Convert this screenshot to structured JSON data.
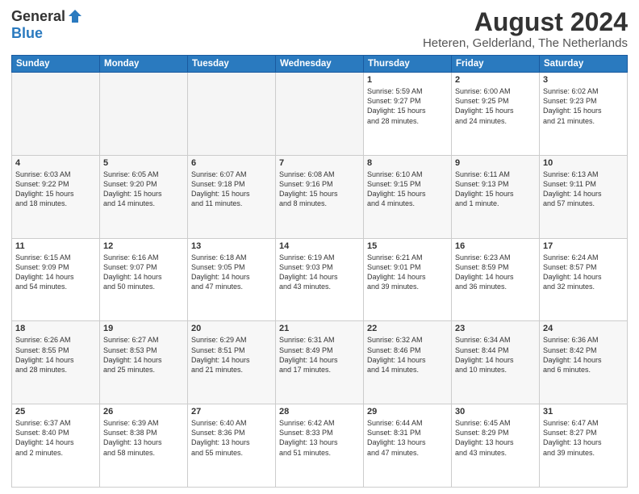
{
  "header": {
    "logo_general": "General",
    "logo_blue": "Blue",
    "month_year": "August 2024",
    "location": "Heteren, Gelderland, The Netherlands"
  },
  "days_of_week": [
    "Sunday",
    "Monday",
    "Tuesday",
    "Wednesday",
    "Thursday",
    "Friday",
    "Saturday"
  ],
  "weeks": [
    [
      {
        "day": "",
        "info": "",
        "empty": true
      },
      {
        "day": "",
        "info": "",
        "empty": true
      },
      {
        "day": "",
        "info": "",
        "empty": true
      },
      {
        "day": "",
        "info": "",
        "empty": true
      },
      {
        "day": "1",
        "info": "Sunrise: 5:59 AM\nSunset: 9:27 PM\nDaylight: 15 hours\nand 28 minutes."
      },
      {
        "day": "2",
        "info": "Sunrise: 6:00 AM\nSunset: 9:25 PM\nDaylight: 15 hours\nand 24 minutes."
      },
      {
        "day": "3",
        "info": "Sunrise: 6:02 AM\nSunset: 9:23 PM\nDaylight: 15 hours\nand 21 minutes."
      }
    ],
    [
      {
        "day": "4",
        "info": "Sunrise: 6:03 AM\nSunset: 9:22 PM\nDaylight: 15 hours\nand 18 minutes."
      },
      {
        "day": "5",
        "info": "Sunrise: 6:05 AM\nSunset: 9:20 PM\nDaylight: 15 hours\nand 14 minutes."
      },
      {
        "day": "6",
        "info": "Sunrise: 6:07 AM\nSunset: 9:18 PM\nDaylight: 15 hours\nand 11 minutes."
      },
      {
        "day": "7",
        "info": "Sunrise: 6:08 AM\nSunset: 9:16 PM\nDaylight: 15 hours\nand 8 minutes."
      },
      {
        "day": "8",
        "info": "Sunrise: 6:10 AM\nSunset: 9:15 PM\nDaylight: 15 hours\nand 4 minutes."
      },
      {
        "day": "9",
        "info": "Sunrise: 6:11 AM\nSunset: 9:13 PM\nDaylight: 15 hours\nand 1 minute."
      },
      {
        "day": "10",
        "info": "Sunrise: 6:13 AM\nSunset: 9:11 PM\nDaylight: 14 hours\nand 57 minutes."
      }
    ],
    [
      {
        "day": "11",
        "info": "Sunrise: 6:15 AM\nSunset: 9:09 PM\nDaylight: 14 hours\nand 54 minutes."
      },
      {
        "day": "12",
        "info": "Sunrise: 6:16 AM\nSunset: 9:07 PM\nDaylight: 14 hours\nand 50 minutes."
      },
      {
        "day": "13",
        "info": "Sunrise: 6:18 AM\nSunset: 9:05 PM\nDaylight: 14 hours\nand 47 minutes."
      },
      {
        "day": "14",
        "info": "Sunrise: 6:19 AM\nSunset: 9:03 PM\nDaylight: 14 hours\nand 43 minutes."
      },
      {
        "day": "15",
        "info": "Sunrise: 6:21 AM\nSunset: 9:01 PM\nDaylight: 14 hours\nand 39 minutes."
      },
      {
        "day": "16",
        "info": "Sunrise: 6:23 AM\nSunset: 8:59 PM\nDaylight: 14 hours\nand 36 minutes."
      },
      {
        "day": "17",
        "info": "Sunrise: 6:24 AM\nSunset: 8:57 PM\nDaylight: 14 hours\nand 32 minutes."
      }
    ],
    [
      {
        "day": "18",
        "info": "Sunrise: 6:26 AM\nSunset: 8:55 PM\nDaylight: 14 hours\nand 28 minutes."
      },
      {
        "day": "19",
        "info": "Sunrise: 6:27 AM\nSunset: 8:53 PM\nDaylight: 14 hours\nand 25 minutes."
      },
      {
        "day": "20",
        "info": "Sunrise: 6:29 AM\nSunset: 8:51 PM\nDaylight: 14 hours\nand 21 minutes."
      },
      {
        "day": "21",
        "info": "Sunrise: 6:31 AM\nSunset: 8:49 PM\nDaylight: 14 hours\nand 17 minutes."
      },
      {
        "day": "22",
        "info": "Sunrise: 6:32 AM\nSunset: 8:46 PM\nDaylight: 14 hours\nand 14 minutes."
      },
      {
        "day": "23",
        "info": "Sunrise: 6:34 AM\nSunset: 8:44 PM\nDaylight: 14 hours\nand 10 minutes."
      },
      {
        "day": "24",
        "info": "Sunrise: 6:36 AM\nSunset: 8:42 PM\nDaylight: 14 hours\nand 6 minutes."
      }
    ],
    [
      {
        "day": "25",
        "info": "Sunrise: 6:37 AM\nSunset: 8:40 PM\nDaylight: 14 hours\nand 2 minutes."
      },
      {
        "day": "26",
        "info": "Sunrise: 6:39 AM\nSunset: 8:38 PM\nDaylight: 13 hours\nand 58 minutes."
      },
      {
        "day": "27",
        "info": "Sunrise: 6:40 AM\nSunset: 8:36 PM\nDaylight: 13 hours\nand 55 minutes."
      },
      {
        "day": "28",
        "info": "Sunrise: 6:42 AM\nSunset: 8:33 PM\nDaylight: 13 hours\nand 51 minutes."
      },
      {
        "day": "29",
        "info": "Sunrise: 6:44 AM\nSunset: 8:31 PM\nDaylight: 13 hours\nand 47 minutes."
      },
      {
        "day": "30",
        "info": "Sunrise: 6:45 AM\nSunset: 8:29 PM\nDaylight: 13 hours\nand 43 minutes."
      },
      {
        "day": "31",
        "info": "Sunrise: 6:47 AM\nSunset: 8:27 PM\nDaylight: 13 hours\nand 39 minutes."
      }
    ]
  ]
}
